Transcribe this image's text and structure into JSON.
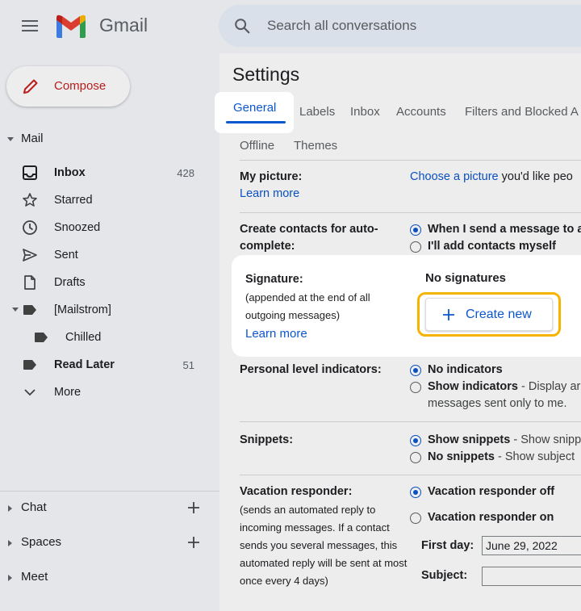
{
  "header": {
    "brand": "Gmail",
    "search_placeholder": "Search all conversations"
  },
  "sidebar": {
    "compose_label": "Compose",
    "mail_label": "Mail",
    "items": [
      {
        "label": "Inbox",
        "count": "428"
      },
      {
        "label": "Starred",
        "count": ""
      },
      {
        "label": "Snoozed",
        "count": ""
      },
      {
        "label": "Sent",
        "count": ""
      },
      {
        "label": "Drafts",
        "count": ""
      },
      {
        "label": "[Mailstrom]",
        "count": ""
      },
      {
        "label": "Chilled",
        "count": ""
      },
      {
        "label": "Read Later",
        "count": "51"
      },
      {
        "label": "More",
        "count": ""
      }
    ],
    "chat_label": "Chat",
    "spaces_label": "Spaces",
    "meet_label": "Meet"
  },
  "settings": {
    "title": "Settings",
    "tabs": [
      "General",
      "Labels",
      "Inbox",
      "Accounts",
      "Filters and Blocked A",
      "Offline",
      "Themes"
    ],
    "my_picture": {
      "label": "My picture:",
      "learn_more": "Learn more",
      "link": "Choose a picture",
      "rest": " you'd like peo"
    },
    "contacts": {
      "label": "Create contacts for auto-complete:",
      "option1": "When I send a message to a",
      "option2": "I'll add contacts myself"
    },
    "signature": {
      "label": "Signature:",
      "note": "(appended at the end of all outgoing messages)",
      "learn_more": "Learn more",
      "status": "No signatures",
      "create_label": "Create new"
    },
    "personal": {
      "label": "Personal level indicators:",
      "option1": "No indicators",
      "option2_bold": "Show indicators",
      "option2_desc": " - Display ar",
      "option2_line2": "messages sent only to me."
    },
    "snippets": {
      "label": "Snippets:",
      "option1_bold": "Show snippets",
      "option1_desc": " - Show snipp",
      "option2_bold": "No snippets",
      "option2_desc": " - Show subject"
    },
    "vacation": {
      "label": "Vacation responder:",
      "note": "(sends an automated reply to incoming messages. If a contact sends you several messages, this automated reply will be sent at most once every 4 days)",
      "option1": "Vacation responder off",
      "option2": "Vacation responder on",
      "first_day_label": "First day:",
      "first_day_value": "June 29, 2022",
      "subject_label": "Subject:",
      "subject_value": ""
    }
  },
  "colors": {
    "accent": "#0b57d0",
    "compose_text": "#c5221f",
    "highlight_ring": "#f4b400"
  }
}
